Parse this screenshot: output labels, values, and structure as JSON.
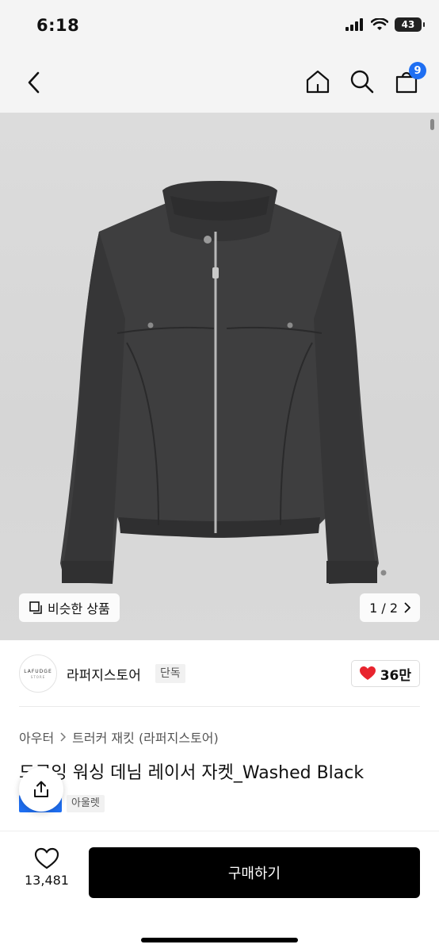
{
  "status": {
    "time": "6:18",
    "battery": "43"
  },
  "nav": {
    "back_icon": "chevron-left-icon",
    "home_icon": "home-icon",
    "search_icon": "search-icon",
    "cart_icon": "shopping-bag-icon",
    "cart_badge": "9",
    "badge_color": "#1f6ff2"
  },
  "gallery": {
    "similar_label": "비슷한 상품",
    "page": "1 / 2"
  },
  "store": {
    "logo_text": "LAFUDGE",
    "logo_subtext": "STORE",
    "name": "라퍼지스토어",
    "exclusive": "단독",
    "likes": "36만",
    "like_color": "#e8242e"
  },
  "product": {
    "breadcrumb": [
      "아우터",
      "트러커 재킷 (라퍼지스토어)"
    ],
    "title": "드로잉 워싱 데님 레이서 자켓_Washed Black",
    "brand_tag": "아울렛"
  },
  "bottom": {
    "wish_count": "13,481",
    "buy_label": "구매하기"
  }
}
